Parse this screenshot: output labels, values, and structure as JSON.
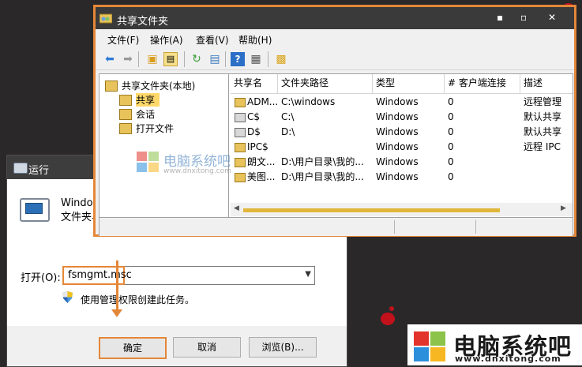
{
  "desktop": {
    "accent": "#c1121b"
  },
  "watermark": {
    "center_title": "电脑系统吧",
    "center_url": "www.dnxitong.com",
    "corner_title": "电脑系统吧",
    "corner_url": "www.dnxitong.com"
  },
  "run_dialog": {
    "title": "运行",
    "description_line1": "Window",
    "description_line2": "文件夹、",
    "open_label": "打开(O):",
    "command_value": "fsmgmt.msc",
    "admin_note": "使用管理权限创建此任务。",
    "buttons": {
      "ok": "确定",
      "cancel": "取消",
      "browse": "浏览(B)..."
    }
  },
  "shared_folders": {
    "title": "共享文件夹",
    "window_controls": {
      "minimize": "▪",
      "maximize": "▫",
      "close": "✕"
    },
    "menu": [
      "文件(F)",
      "操作(A)",
      "查看(V)",
      "帮助(H)"
    ],
    "toolbar_icons": [
      "back-arrow-icon",
      "forward-arrow-icon",
      "up-folder-icon",
      "show-tree-icon",
      "refresh-icon",
      "export-list-icon",
      "help-icon",
      "properties-icon",
      "new-share-icon"
    ],
    "tree": {
      "root": "共享文件夹(本地)",
      "items": [
        "共享",
        "会话",
        "打开文件"
      ],
      "selected": "共享"
    },
    "columns": [
      "共享名",
      "文件夹路径",
      "类型",
      "# 客户端连接",
      "描述"
    ],
    "rows": [
      {
        "name": "ADM...",
        "path": "C:\\windows",
        "type": "Windows",
        "clients": "0",
        "desc": "远程管理"
      },
      {
        "name": "C$",
        "path": "C:\\",
        "type": "Windows",
        "clients": "0",
        "desc": "默认共享"
      },
      {
        "name": "D$",
        "path": "D:\\",
        "type": "Windows",
        "clients": "0",
        "desc": "默认共享"
      },
      {
        "name": "IPC$",
        "path": "",
        "type": "Windows",
        "clients": "0",
        "desc": "远程 IPC"
      },
      {
        "name": "朗文...",
        "path": "D:\\用户目录\\我的...",
        "type": "Windows",
        "clients": "0",
        "desc": ""
      },
      {
        "name": "美图...",
        "path": "D:\\用户目录\\我的...",
        "type": "Windows",
        "clients": "0",
        "desc": ""
      }
    ],
    "highlight_color": "#e48738",
    "selection_color": "#ffd86a"
  }
}
